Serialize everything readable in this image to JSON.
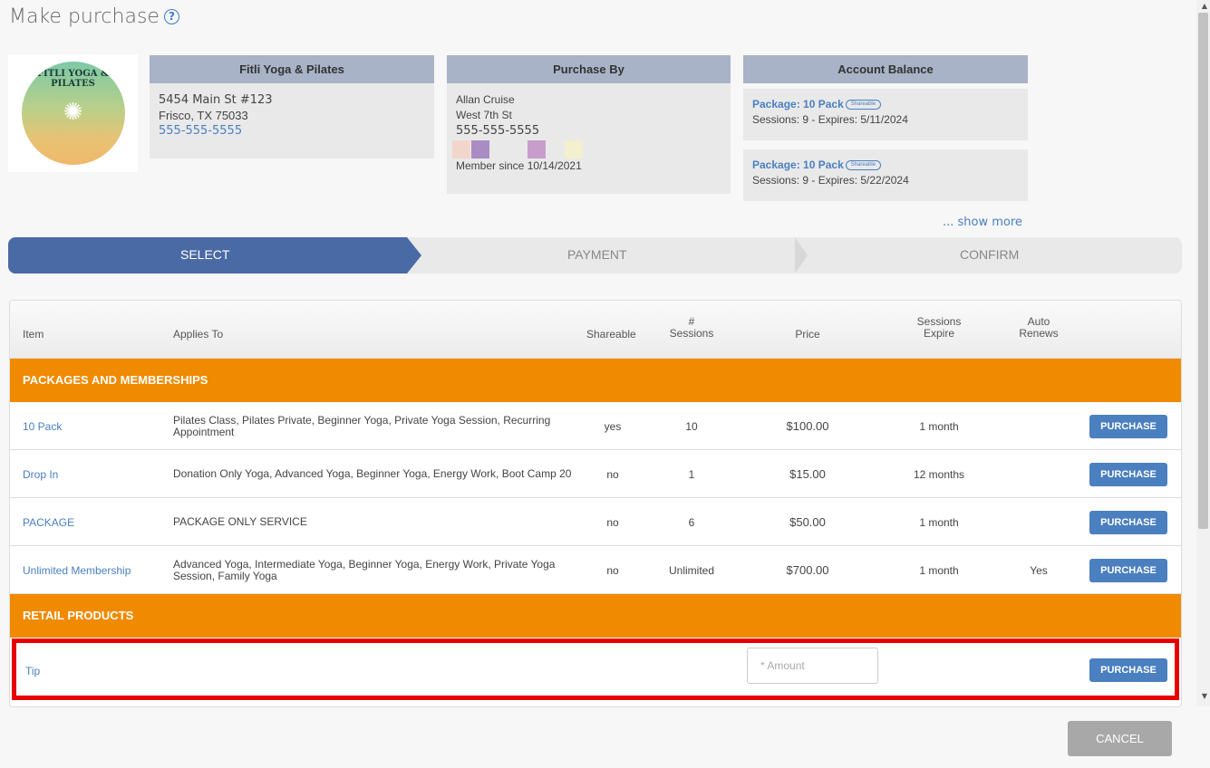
{
  "page": {
    "title": "Make purchase",
    "help_icon": "help-circle-icon"
  },
  "logo": {
    "text": "FITLI YOGA & PILATES"
  },
  "studio": {
    "name": "Fitli Yoga & Pilates",
    "address1": "5454 Main St #123",
    "address2": "Frisco, TX 75033",
    "phone": "555-555-5555"
  },
  "purchaser": {
    "header": "Purchase By",
    "name": "Allan Cruise",
    "street": "West 7th St",
    "phone": "555-555-5555",
    "member_since": "Member since 10/14/2021",
    "swatch_colors": [
      "#f2d6cc",
      "#a98cc4",
      "#c79ecb",
      "#f3efcf"
    ]
  },
  "balance": {
    "header": "Account Balance",
    "packages": [
      {
        "title": "Package: 10 Pack",
        "chip": "Shareable",
        "detail": "Sessions: 9 - Expires: 5/11/2024"
      },
      {
        "title": "Package: 10 Pack",
        "chip": "Shareable",
        "detail": "Sessions: 9 - Expires: 5/22/2024"
      }
    ],
    "show_more": "... show more"
  },
  "steps": {
    "select": "SELECT",
    "payment": "PAYMENT",
    "confirm": "CONFIRM"
  },
  "table": {
    "headers": {
      "item": "Item",
      "applies": "Applies To",
      "shareable": "Shareable",
      "sessions_hash": "#",
      "sessions": "Sessions",
      "price": "Price",
      "expire_1": "Sessions",
      "expire_2": "Expire",
      "auto_1": "Auto",
      "auto_2": "Renews"
    },
    "section_packages": "PACKAGES AND MEMBERSHIPS",
    "rows": [
      {
        "item": "10 Pack",
        "applies": "Pilates Class, Pilates Private, Beginner Yoga, Private Yoga Session, Recurring Appointment",
        "shareable": "yes",
        "sessions": "10",
        "price": "$100.00",
        "expire": "1 month",
        "auto": "",
        "button": "PURCHASE"
      },
      {
        "item": "Drop In",
        "applies": "Donation Only Yoga, Advanced Yoga, Beginner Yoga, Energy Work, Boot Camp 20",
        "shareable": "no",
        "sessions": "1",
        "price": "$15.00",
        "expire": "12 months",
        "auto": "",
        "button": "PURCHASE"
      },
      {
        "item": "PACKAGE",
        "applies": "PACKAGE ONLY SERVICE",
        "shareable": "no",
        "sessions": "6",
        "price": "$50.00",
        "expire": "1 month",
        "auto": "",
        "button": "PURCHASE"
      },
      {
        "item": "Unlimited Membership",
        "applies": "Advanced Yoga, Intermediate Yoga, Beginner Yoga, Energy Work, Private Yoga Session, Family Yoga",
        "shareable": "no",
        "sessions": "Unlimited",
        "price": "$700.00",
        "expire": "1 month",
        "auto": "Yes",
        "button": "PURCHASE"
      }
    ],
    "section_retail": "RETAIL PRODUCTS",
    "tip": {
      "item": "Tip",
      "amount_placeholder": "* Amount",
      "button": "PURCHASE"
    }
  },
  "footer": {
    "cancel": "CANCEL"
  },
  "colors": {
    "accent": "#4a7fc0",
    "step_active": "#4a6aa5",
    "section": "#f08a00",
    "highlight": "#e80000"
  }
}
